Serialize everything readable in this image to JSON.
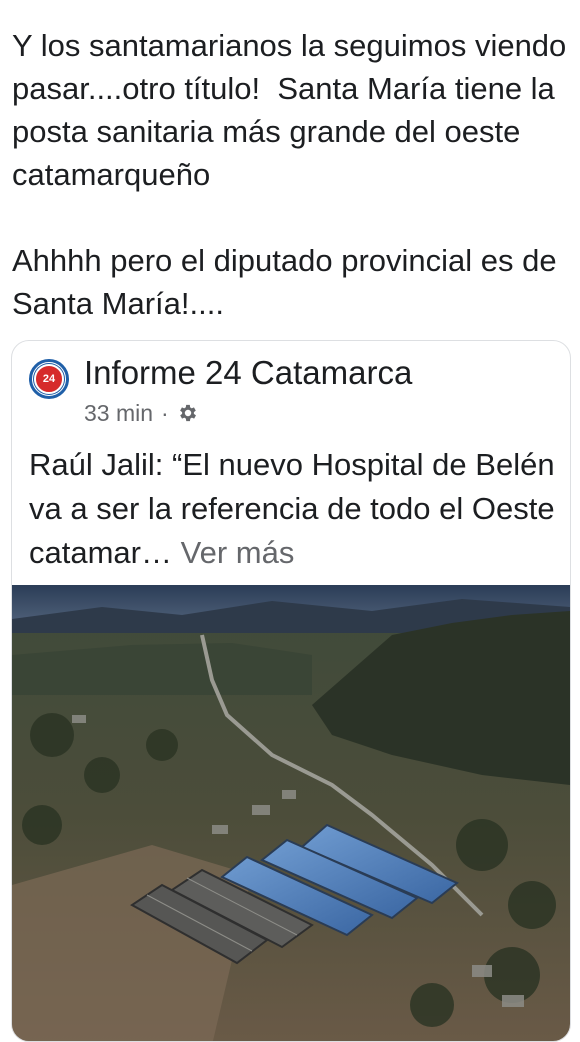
{
  "post": {
    "text": "Y los santamarianos la seguimos viendo pasar....otro título!  Santa María tiene la posta sanitaria más grande del oeste catamarqueño\n\nAhhhh pero el diputado provincial es de Santa María!...."
  },
  "shared_post": {
    "page_name": "Informe 24 Catamarca",
    "avatar_text": "24",
    "time": "33 min",
    "separator": "·",
    "privacy_icon": "gear-icon",
    "text": "Raúl Jalil: “El nuevo Hospital de Belén va a ser la referencia de todo el Oeste catamar… ",
    "see_more": "Ver más"
  },
  "colors": {
    "text_primary": "#1c1e21",
    "text_secondary": "#65676b",
    "card_border": "#dddfe2",
    "hospital_roof": "#4a78b5"
  }
}
